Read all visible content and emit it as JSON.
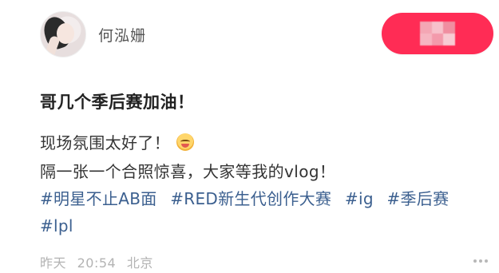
{
  "user": {
    "name": "何泓姗",
    "avatar_icon": "user-avatar-photo"
  },
  "follow_button": {
    "color": "#ff2c55",
    "label_obscured": true
  },
  "post": {
    "title": "哥几个季后赛加油！",
    "line1": "现场氛围太好了！",
    "line1_emoji": "smiling-face-emoji",
    "line2": "隔一张一个合照惊喜，大家等我的vlog！",
    "tags": [
      "#明星不止AB面",
      "#RED新生代创作大赛",
      "#ig",
      "#季后赛",
      "#lpl"
    ],
    "tag_color": "#3b5f8f"
  },
  "meta": {
    "day": "昨天",
    "time": "20:54",
    "location": "北京"
  }
}
